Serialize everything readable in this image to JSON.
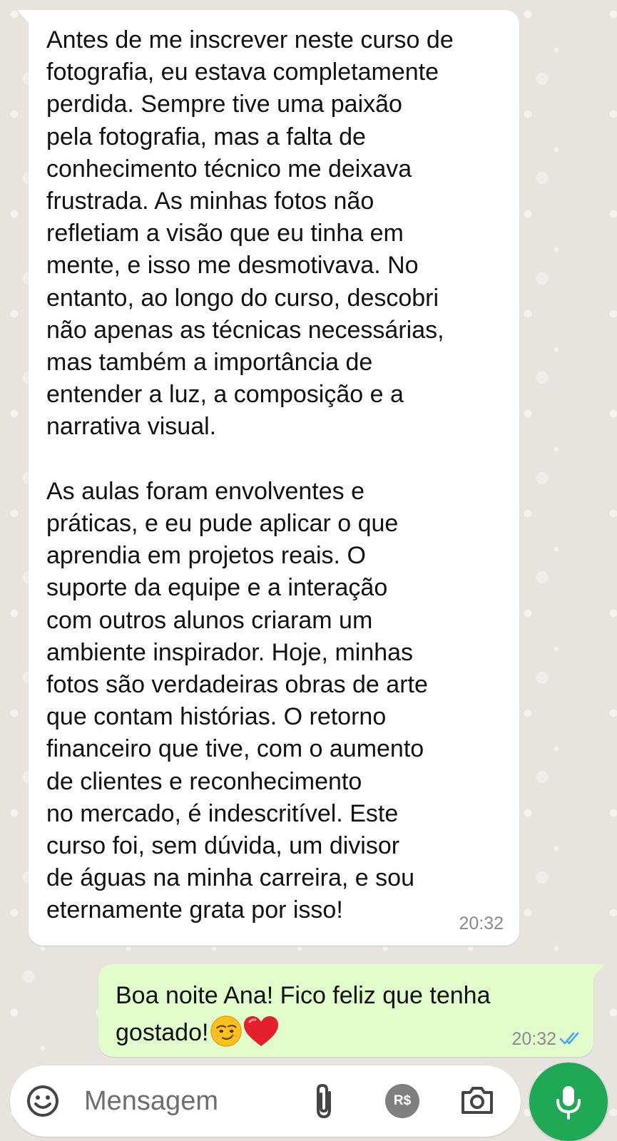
{
  "colors": {
    "chat_background": "#e7e4df",
    "incoming_bubble": "#ffffff",
    "outgoing_bubble": "#e2fdcc",
    "read_ticks": "#4fa6e8",
    "mic_button": "#1fa855"
  },
  "messages": {
    "incoming": {
      "text": "Antes de me inscrever neste curso de\nfotografia, eu estava completamente\nperdida. Sempre tive uma paixão\npela fotografia, mas a falta de\nconhecimento técnico me deixava\nfrustrada. As minhas fotos não\nrefletiam a visão que eu tinha em\nmente, e isso me desmotivava. No\nentanto, ao longo do curso, descobri\nnão apenas as técnicas necessárias,\nmas também a importância de\nentender a luz, a composição e a\nnarrativa visual.\n\nAs aulas foram envolventes e\npráticas, e eu pude aplicar o que\naprendia em projetos reais. O\nsuporte da equipe e a interação\ncom outros alunos criaram um\nambiente inspirador. Hoje, minhas\nfotos são verdadeiras obras de arte\nque contam histórias. O retorno\nfinanceiro que tive, com o aumento\nde clientes e reconhecimento\nno mercado, é indescritível. Este\ncurso foi, sem dúvida, um divisor\nde águas na minha carreira, e sou\neternamente grata por isso!",
      "time": "20:32"
    },
    "outgoing": {
      "text_line1": "Boa noite Ana! Fico feliz que tenha",
      "text_line2": "gostado!",
      "emojis": [
        "smirking-face-emoji",
        "red-heart-emoji"
      ],
      "time": "20:32",
      "status_icon": "double-check-read-icon"
    }
  },
  "composer": {
    "placeholder": "Mensagem",
    "emoji_icon": "smiley-icon",
    "attach_icon": "paperclip-icon",
    "payment_label": "R$",
    "camera_icon": "camera-icon",
    "mic_icon": "microphone-icon"
  }
}
